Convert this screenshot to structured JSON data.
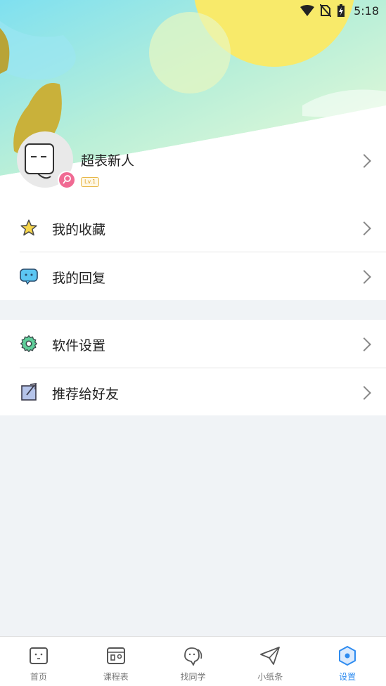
{
  "status_bar": {
    "time": "5:18"
  },
  "profile": {
    "username": "超表新人",
    "level": "Lv.1"
  },
  "menu_group_1": [
    {
      "label": "我的收藏",
      "icon": "star-icon"
    },
    {
      "label": "我的回复",
      "icon": "chat-bubble-icon"
    }
  ],
  "menu_group_2": [
    {
      "label": "软件设置",
      "icon": "gear-icon"
    },
    {
      "label": "推荐给好友",
      "icon": "share-icon"
    }
  ],
  "tabs": [
    {
      "label": "首页",
      "icon": "home-face-icon",
      "active": false
    },
    {
      "label": "课程表",
      "icon": "schedule-icon",
      "active": false
    },
    {
      "label": "找同学",
      "icon": "classmates-icon",
      "active": false
    },
    {
      "label": "小纸条",
      "icon": "paper-plane-icon",
      "active": false
    },
    {
      "label": "设置",
      "icon": "settings-hexagon-icon",
      "active": true
    }
  ],
  "colors": {
    "accent": "#2f8cf0",
    "background": "#f0f3f6",
    "gender_badge": "#f06a93",
    "level_badge": "#e0a52a"
  }
}
